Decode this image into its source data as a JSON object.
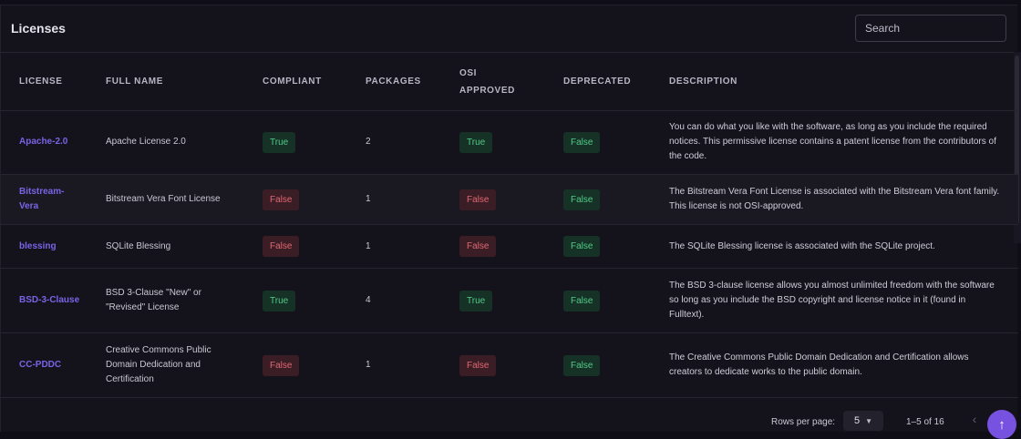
{
  "page": {
    "title": "Licenses"
  },
  "search": {
    "placeholder": "Search"
  },
  "table": {
    "columns": {
      "license": "LICENSE",
      "full_name": "FULL NAME",
      "compliant": "COMPLIANT",
      "packages": "PACKAGES",
      "osi_approved": "OSI APPROVED",
      "deprecated": "DEPRECATED",
      "description": "DESCRIPTION"
    },
    "rows": [
      {
        "license": "Apache-2.0",
        "full_name": "Apache License 2.0",
        "compliant": "True",
        "packages": "2",
        "osi_approved": "True",
        "deprecated": "False",
        "description": "You can do what you like with the software, as long as you include the required notices. This permissive license contains a patent license from the contributors of the code."
      },
      {
        "license": "Bitstream-Vera",
        "full_name": "Bitstream Vera Font License",
        "compliant": "False",
        "packages": "1",
        "osi_approved": "False",
        "deprecated": "False",
        "description": "The Bitstream Vera Font License is associated with the Bitstream Vera font family. This license is not OSI-approved."
      },
      {
        "license": "blessing",
        "full_name": "SQLite Blessing",
        "compliant": "False",
        "packages": "1",
        "osi_approved": "False",
        "deprecated": "False",
        "description": "The SQLite Blessing license is associated with the SQLite project."
      },
      {
        "license": "BSD-3-Clause",
        "full_name": "BSD 3-Clause \"New\" or \"Revised\" License",
        "compliant": "True",
        "packages": "4",
        "osi_approved": "True",
        "deprecated": "False",
        "description": "The BSD 3-clause license allows you almost unlimited freedom with the software so long as you include the BSD copyright and license notice in it (found in Fulltext)."
      },
      {
        "license": "CC-PDDC",
        "full_name": "Creative Commons Public Domain Dedication and Certification",
        "compliant": "False",
        "packages": "1",
        "osi_approved": "False",
        "deprecated": "False",
        "description": "The Creative Commons Public Domain Dedication and Certification allows creators to dedicate works to the public domain."
      }
    ]
  },
  "pagination": {
    "rows_per_page_label": "Rows per page:",
    "rows_per_page": "5",
    "range": "1–5 of 16"
  },
  "icons": {
    "prev": "chevron-left-icon",
    "scroll_top": "arrow-up-icon",
    "dropdown": "caret-down-icon"
  },
  "colors": {
    "accent": "#7b63e6",
    "true_badge_bg": "#163126",
    "true_badge_text": "#4fcc87",
    "false_badge_bg": "#3b1e25",
    "false_badge_text": "#e06673"
  }
}
